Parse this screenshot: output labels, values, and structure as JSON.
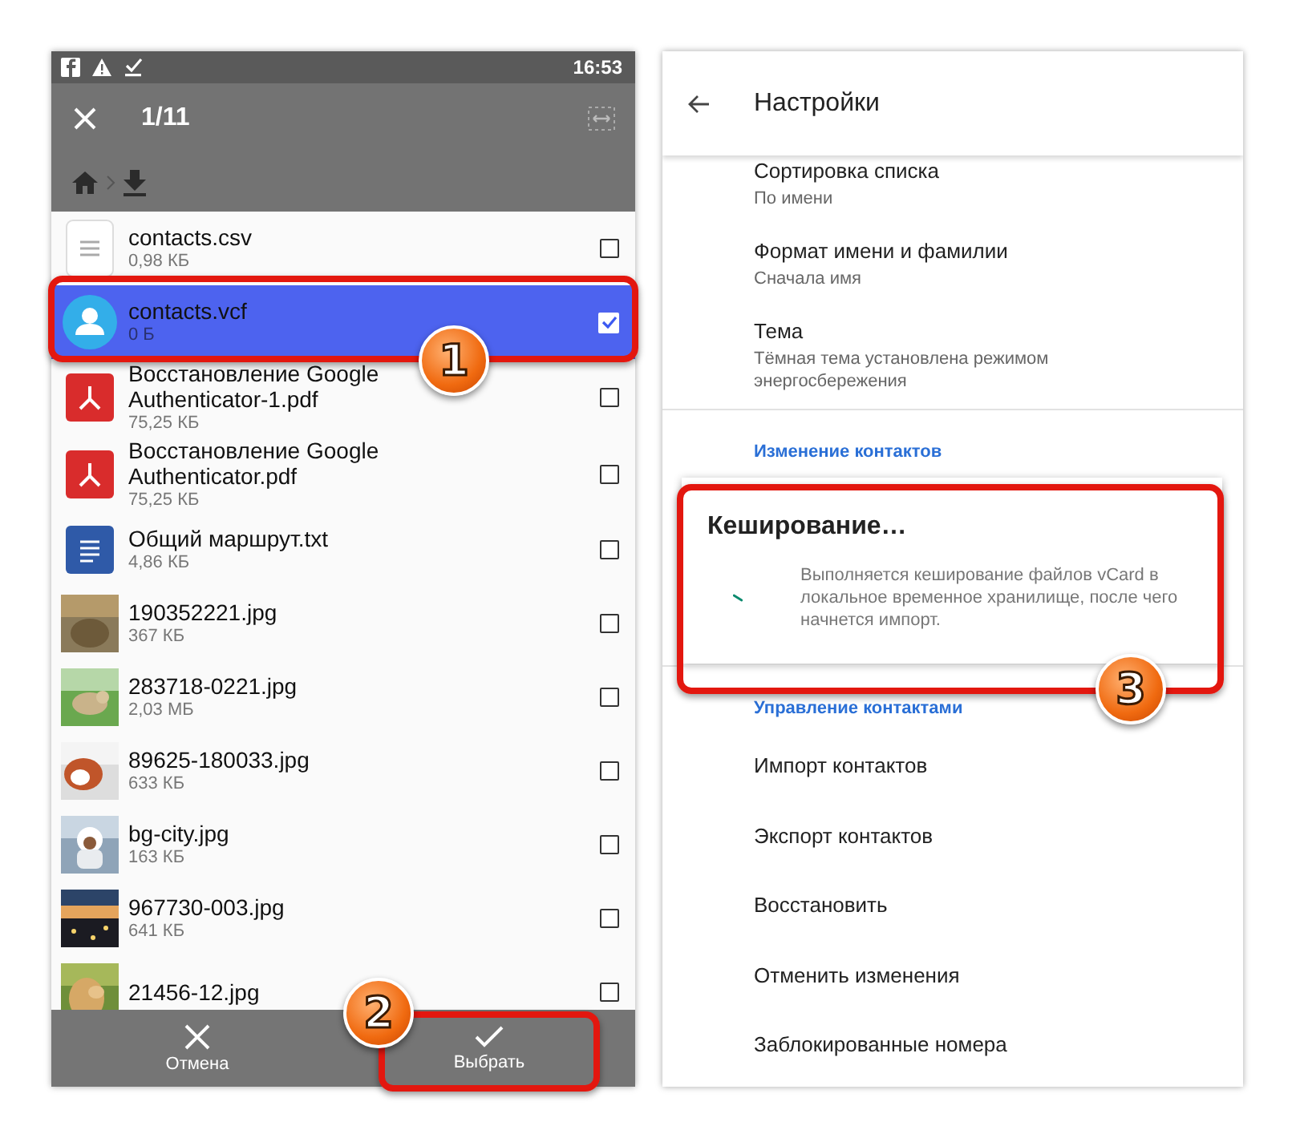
{
  "file_picker": {
    "status_bar": {
      "time": "16:53"
    },
    "toolbar": {
      "counter": "1/11"
    },
    "files": [
      {
        "kind": "document",
        "name": "contacts.csv",
        "size": "0,98 КБ",
        "selected": false
      },
      {
        "kind": "contact",
        "name": "contacts.vcf",
        "size": "0 Б",
        "selected": true
      },
      {
        "kind": "pdf",
        "name": "Восстановление Google Authenticator-1.pdf",
        "size": "75,25 КБ",
        "selected": false
      },
      {
        "kind": "pdf",
        "name": "Восстановление Google Authenticator.pdf",
        "size": "75,25 КБ",
        "selected": false
      },
      {
        "kind": "text",
        "name": "Общий маршрут.txt",
        "size": "4,86 КБ",
        "selected": false
      },
      {
        "name": "190352221.jpg",
        "size": "367 КБ",
        "selected": false
      },
      {
        "name": "283718-0221.jpg",
        "size": "2,03 МБ",
        "selected": false
      },
      {
        "name": "89625-180033.jpg",
        "size": "633 КБ",
        "selected": false
      },
      {
        "name": "bg-city.jpg",
        "size": "163 КБ",
        "selected": false
      },
      {
        "name": "967730-003.jpg",
        "size": "641 КБ",
        "selected": false
      },
      {
        "name": "21456-12.jpg",
        "selected": false
      }
    ],
    "actions": [
      {
        "kind": "cancel",
        "label": "Отмена"
      },
      {
        "kind": "confirm",
        "label": "Выбрать"
      }
    ]
  },
  "settings": {
    "title": "Настройки",
    "items": [
      {
        "kind": "setting",
        "title": "Сортировка списка",
        "subtitle": "По имени"
      },
      {
        "kind": "setting",
        "title": "Формат имени и фамилии",
        "subtitle": "Сначала имя"
      },
      {
        "kind": "setting",
        "title": "Тема",
        "subtitle": "Тёмная тема установлена режимом энергосбережения"
      },
      {
        "kind": "section",
        "title": "Изменение контактов"
      },
      {
        "kind": "dialog",
        "title": "Кеширование…",
        "message": "Выполняется кеширование файлов vCard в локальное временное хранилище, после чего начнется импорт."
      },
      {
        "kind": "section",
        "title": "Управление контактами"
      },
      {
        "kind": "action",
        "title": "Импорт контактов"
      },
      {
        "kind": "action",
        "title": "Экспорт контактов"
      },
      {
        "kind": "action",
        "title": "Восстановить"
      },
      {
        "kind": "action",
        "title": "Отменить изменения"
      },
      {
        "kind": "action",
        "title": "Заблокированные номера"
      }
    ]
  },
  "callouts": [
    {
      "label": "1"
    },
    {
      "label": "2"
    },
    {
      "label": "3"
    }
  ]
}
